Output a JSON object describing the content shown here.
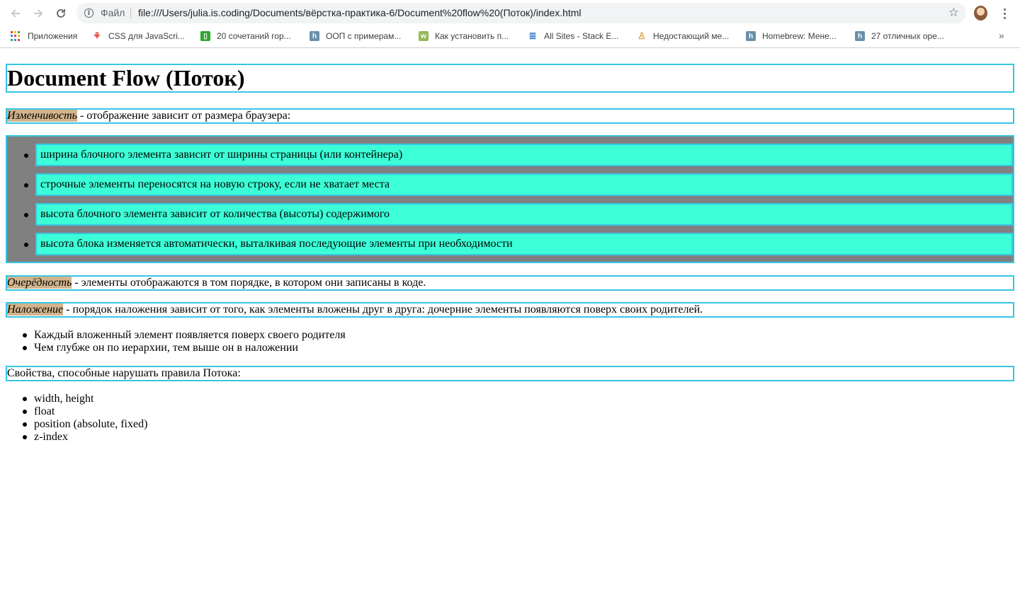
{
  "browser": {
    "scheme_label": "Файл",
    "url": "file:///Users/julia.is.coding/Documents/вёрстка-практика-6/Document%20flow%20(Поток)/index.html",
    "bookmarks": [
      {
        "label": "Приложения",
        "icon": "apps-icon"
      },
      {
        "label": "CSS для JavaScri...",
        "icon": "css-icon"
      },
      {
        "label": "20 сочетаний гор...",
        "icon": "keyboard-icon"
      },
      {
        "label": "ООП с примерам...",
        "icon": "habr-icon"
      },
      {
        "label": "Как установить п...",
        "icon": "wikihow-icon"
      },
      {
        "label": "All Sites - Stack E...",
        "icon": "stackexchange-icon"
      },
      {
        "label": "Недостающий ме...",
        "icon": "homebrew-icon"
      },
      {
        "label": "Homebrew: Мене...",
        "icon": "habr-icon"
      },
      {
        "label": "27 отличных оре...",
        "icon": "habr-icon"
      }
    ],
    "more_bookmarks": "»"
  },
  "page": {
    "title": "Document Flow (Поток)",
    "variability": {
      "term": "Изменчивость",
      "text": " - отображение зависит от размера браузера:"
    },
    "variability_items": [
      "ширина блочного элемента зависит от ширины страницы (или контейнера)",
      "строчные элементы переносятся на новую строку, если не хватает места",
      "высота блочного элемента зависит от количества (высоты) содержимого",
      "высота блока изменяется автоматически, выталкивая последующие элементы при необходимости"
    ],
    "order": {
      "term": "Очерёдность",
      "text": " - элементы отображаются в том порядке, в котором они записаны в коде."
    },
    "stacking": {
      "term": "Наложение",
      "text": " - порядок наложения зависит от того, как элементы вложены друг в друга: дочерние элементы появляются поверх своих родителей."
    },
    "stacking_items": [
      "Каждый вложенный элемент появляется поверх своего родителя",
      "Чем глубже он по иерархии, тем выше он в наложении"
    ],
    "properties_intro": "Свойства, способные нарушать правила Потока:",
    "properties": [
      "width, height",
      "float",
      "position (absolute, fixed)",
      "z-index"
    ]
  }
}
